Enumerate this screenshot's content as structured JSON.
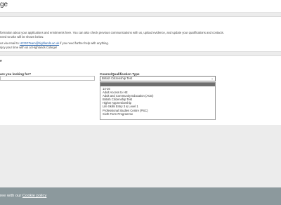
{
  "header": {
    "title": "ge"
  },
  "intro": {
    "line1": "formation about your applications and enrolments here. You can also check previous communications with us, upload evidence, and update your qualifications and contacts.",
    "line2": "need to take will be shown below.",
    "line3_prefix": "us via email to ",
    "line3_email": "HCOGTeam@highlands.ac.uk",
    "line3_suffix": " if you need further help with anything.",
    "line4": "njoy your time with us at Highlands College!"
  },
  "search": {
    "section_title": "e",
    "keyword_label": "are you looking for?",
    "course_label": "Course/Qualification Type",
    "selected_value": "British Citizenship Test",
    "options": [
      "",
      "14-16",
      "Adult Access to HE",
      "Adult and Community Education (ACE)",
      "British Citizenship Test",
      "Higher Apprenticeship",
      "Life Skills Entry 3 & Level 1",
      "Professional Studies Centre (PSC)",
      "Sixth Form Programme"
    ]
  },
  "cookie_bar": {
    "text_prefix": "ree with our ",
    "link_text": "Cookie policy"
  }
}
